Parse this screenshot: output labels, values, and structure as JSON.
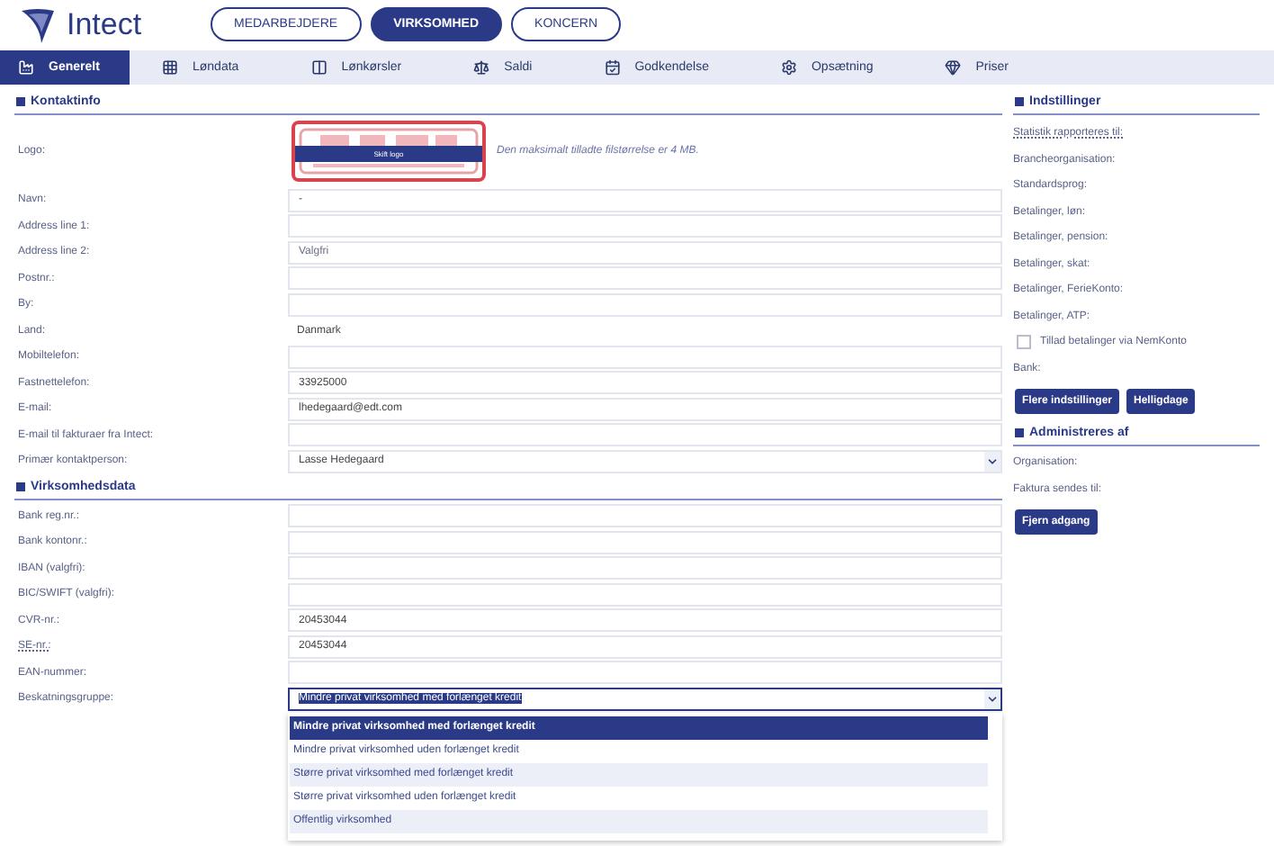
{
  "header": {
    "brand": "Intect",
    "nav": [
      {
        "label": "MEDARBEJDERE",
        "selected": false
      },
      {
        "label": "VIRKSOMHED",
        "selected": true
      },
      {
        "label": "KONCERN",
        "selected": false
      }
    ]
  },
  "tabs": [
    {
      "label": "Generelt",
      "selected": true
    },
    {
      "label": "Løndata",
      "selected": false
    },
    {
      "label": "Lønkørsler",
      "selected": false
    },
    {
      "label": "Saldi",
      "selected": false
    },
    {
      "label": "Godkendelse",
      "selected": false
    },
    {
      "label": "Opsætning",
      "selected": false
    },
    {
      "label": "Priser",
      "selected": false
    }
  ],
  "contact": {
    "title": "Kontaktinfo",
    "logo": {
      "label": "Logo:",
      "button": "Skift logo",
      "hint": "Den maksimalt tilladte filstørrelse er 4 MB."
    },
    "fields": [
      {
        "label": "Navn:",
        "kind": "input",
        "value": "-"
      },
      {
        "label": "Address line 1:",
        "kind": "input"
      },
      {
        "label": "Address line 2:",
        "kind": "input",
        "placeholder": "Valgfri"
      },
      {
        "label": "Postnr.:",
        "kind": "input"
      },
      {
        "label": "By:",
        "kind": "input"
      },
      {
        "label": "Land:",
        "kind": "text",
        "value": "Danmark"
      },
      {
        "label": "Mobiltelefon:",
        "kind": "input"
      },
      {
        "label": "Fastnettelefon:",
        "kind": "input",
        "value": "33925000"
      },
      {
        "label": "E-mail:",
        "kind": "input",
        "value": "lhedegaard@edt.com"
      },
      {
        "label": "E-mail til fakturaer fra Intect:",
        "kind": "input"
      },
      {
        "label": "Primær kontaktperson:",
        "kind": "select",
        "value": "Lasse Hedegaard"
      }
    ]
  },
  "company": {
    "title": "Virksomhedsdata",
    "fields": [
      {
        "label": "Bank reg.nr.:",
        "kind": "input"
      },
      {
        "label": "Bank kontonr.:",
        "kind": "input"
      },
      {
        "label": "IBAN (valgfri):",
        "kind": "input"
      },
      {
        "label": "BIC/SWIFT (valgfri):",
        "kind": "input"
      },
      {
        "label": "CVR-nr.:",
        "kind": "input",
        "value": "20453044"
      },
      {
        "label": "SE-nr.:",
        "kind": "input",
        "value": "20453044",
        "hint": true
      },
      {
        "label": "EAN-nummer:",
        "kind": "input"
      },
      {
        "label": "Beskatningsgruppe:",
        "kind": "select",
        "value": "Mindre privat virksomhed med forlænget kredit",
        "open": true
      }
    ],
    "options": [
      {
        "label": "Mindre privat virksomhed med forlænget kredit",
        "selected": true
      },
      {
        "label": "Mindre privat virksomhed uden forlænget kredit",
        "selected": false
      },
      {
        "label": "Større privat virksomhed med forlænget kredit",
        "selected": false
      },
      {
        "label": "Større privat virksomhed uden forlænget kredit",
        "selected": false
      },
      {
        "label": "Offentlig virksomhed",
        "selected": false
      }
    ]
  },
  "settings": {
    "title": "Indstillinger",
    "items": [
      {
        "kind": "label",
        "label": "Statistik rapporteres til:",
        "hint": true
      },
      {
        "kind": "label",
        "label": "Brancheorganisation:"
      },
      {
        "kind": "label",
        "label": "Standardsprog:"
      },
      {
        "kind": "label",
        "label": "Betalinger, løn:"
      },
      {
        "kind": "label",
        "label": "Betalinger, pension:"
      },
      {
        "kind": "label",
        "label": "Betalinger, skat:"
      },
      {
        "kind": "label",
        "label": "Betalinger, FerieKonto:"
      },
      {
        "kind": "label",
        "label": "Betalinger, ATP:"
      },
      {
        "kind": "checkbox",
        "label": "Tillad betalinger via NemKonto",
        "checked": false
      },
      {
        "kind": "label",
        "label": "Bank:"
      }
    ],
    "buttons": [
      "Flere indstillinger",
      "Helligdage"
    ]
  },
  "admin": {
    "title": "Administreres af",
    "items": [
      "Organisation:",
      "Faktura sendes til:"
    ],
    "buttons": [
      "Fjern adgang"
    ]
  }
}
